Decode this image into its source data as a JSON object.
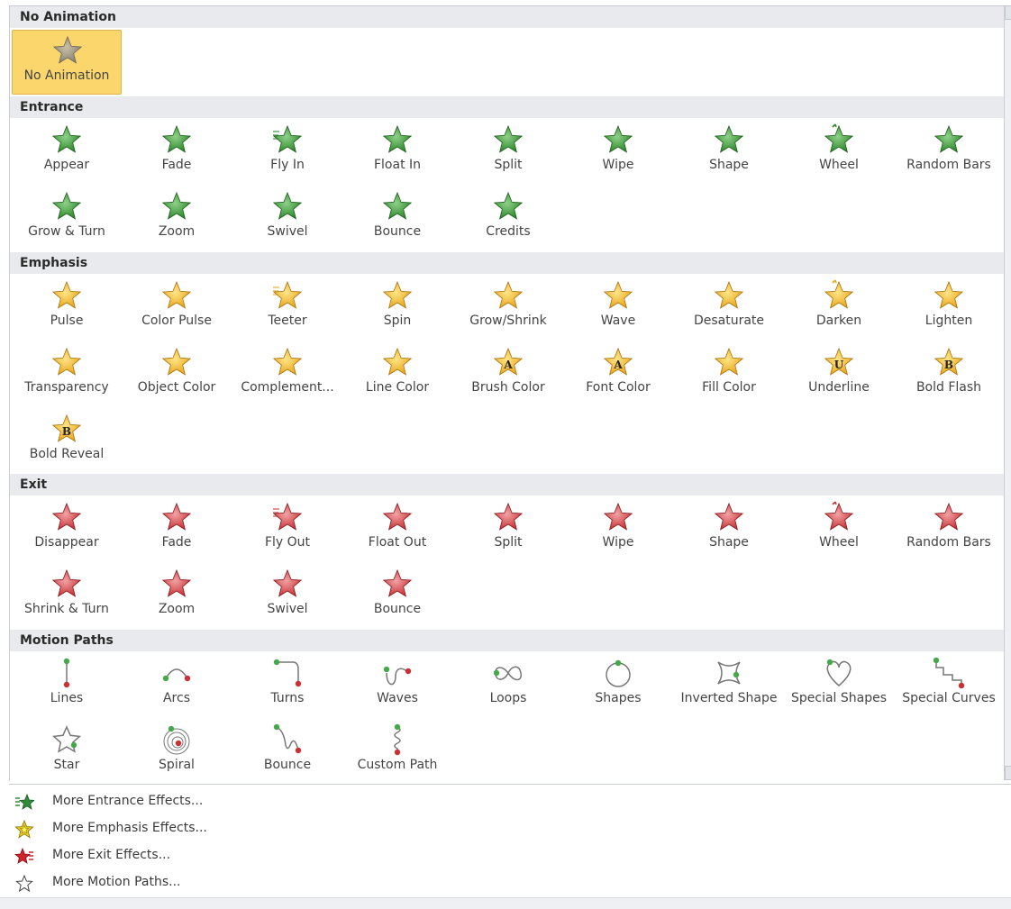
{
  "sections": [
    {
      "title": "No Animation",
      "items": [
        {
          "label": "No Animation",
          "icon": "gray-star-icon",
          "selected": true
        }
      ]
    },
    {
      "title": "Entrance",
      "items": [
        {
          "label": "Appear",
          "icon": "green-star-icon"
        },
        {
          "label": "Fade",
          "icon": "green-star-icon"
        },
        {
          "label": "Fly In",
          "icon": "green-star-icon"
        },
        {
          "label": "Float In",
          "icon": "green-star-icon"
        },
        {
          "label": "Split",
          "icon": "green-star-icon"
        },
        {
          "label": "Wipe",
          "icon": "green-star-icon"
        },
        {
          "label": "Shape",
          "icon": "green-star-icon"
        },
        {
          "label": "Wheel",
          "icon": "green-star-icon"
        },
        {
          "label": "Random Bars",
          "icon": "green-star-icon"
        },
        {
          "label": "Grow & Turn",
          "icon": "green-star-icon"
        },
        {
          "label": "Zoom",
          "icon": "green-star-icon"
        },
        {
          "label": "Swivel",
          "icon": "green-star-icon"
        },
        {
          "label": "Bounce",
          "icon": "green-star-icon"
        },
        {
          "label": "Credits",
          "icon": "green-star-icon"
        }
      ]
    },
    {
      "title": "Emphasis",
      "items": [
        {
          "label": "Pulse",
          "icon": "gold-star-icon"
        },
        {
          "label": "Color Pulse",
          "icon": "gold-star-icon"
        },
        {
          "label": "Teeter",
          "icon": "gold-star-icon"
        },
        {
          "label": "Spin",
          "icon": "gold-star-icon"
        },
        {
          "label": "Grow/Shrink",
          "icon": "gold-star-icon"
        },
        {
          "label": "Wave",
          "icon": "gold-star-icon"
        },
        {
          "label": "Desaturate",
          "icon": "gold-star-icon"
        },
        {
          "label": "Darken",
          "icon": "gold-star-icon"
        },
        {
          "label": "Lighten",
          "icon": "gold-star-icon"
        },
        {
          "label": "Transparency",
          "icon": "gold-star-icon"
        },
        {
          "label": "Object Color",
          "icon": "gold-star-icon"
        },
        {
          "label": "Complement...",
          "icon": "gold-star-icon"
        },
        {
          "label": "Line Color",
          "icon": "gold-star-icon"
        },
        {
          "label": "Brush Color",
          "icon": "gold-star-icon",
          "glyph": "A"
        },
        {
          "label": "Font Color",
          "icon": "gold-star-icon",
          "glyph": "A"
        },
        {
          "label": "Fill Color",
          "icon": "gold-star-icon"
        },
        {
          "label": "Underline",
          "icon": "gold-star-icon",
          "glyph": "U"
        },
        {
          "label": "Bold Flash",
          "icon": "gold-star-icon",
          "glyph": "B"
        },
        {
          "label": "Bold Reveal",
          "icon": "gold-star-icon",
          "glyph": "B"
        }
      ]
    },
    {
      "title": "Exit",
      "items": [
        {
          "label": "Disappear",
          "icon": "red-star-icon"
        },
        {
          "label": "Fade",
          "icon": "red-star-icon"
        },
        {
          "label": "Fly Out",
          "icon": "red-star-icon"
        },
        {
          "label": "Float Out",
          "icon": "red-star-icon"
        },
        {
          "label": "Split",
          "icon": "red-star-icon"
        },
        {
          "label": "Wipe",
          "icon": "red-star-icon"
        },
        {
          "label": "Shape",
          "icon": "red-star-icon"
        },
        {
          "label": "Wheel",
          "icon": "red-star-icon"
        },
        {
          "label": "Random Bars",
          "icon": "red-star-icon"
        },
        {
          "label": "Shrink & Turn",
          "icon": "red-star-icon"
        },
        {
          "label": "Zoom",
          "icon": "red-star-icon"
        },
        {
          "label": "Swivel",
          "icon": "red-star-icon"
        },
        {
          "label": "Bounce",
          "icon": "red-star-icon"
        }
      ]
    },
    {
      "title": "Motion Paths",
      "items": [
        {
          "label": "Lines",
          "icon": "line-path-icon"
        },
        {
          "label": "Arcs",
          "icon": "arc-path-icon"
        },
        {
          "label": "Turns",
          "icon": "turn-path-icon"
        },
        {
          "label": "Waves",
          "icon": "wave-path-icon"
        },
        {
          "label": "Loops",
          "icon": "loop-path-icon"
        },
        {
          "label": "Shapes",
          "icon": "circle-path-icon"
        },
        {
          "label": "Inverted Shape",
          "icon": "inverted-shape-path-icon"
        },
        {
          "label": "Special Shapes",
          "icon": "heart-path-icon"
        },
        {
          "label": "Special Curves",
          "icon": "stair-path-icon"
        },
        {
          "label": "Star",
          "icon": "star-path-icon"
        },
        {
          "label": "Spiral",
          "icon": "spiral-path-icon"
        },
        {
          "label": "Bounce",
          "icon": "bounce-path-icon"
        },
        {
          "label": "Custom Path",
          "icon": "custom-path-icon"
        }
      ]
    }
  ],
  "more": [
    {
      "label": "More Entrance Effects...",
      "icon": "entrance-star-icon",
      "color": "#2e8b3a"
    },
    {
      "label": "More Emphasis Effects...",
      "icon": "emphasis-star-icon",
      "color": "#f2d21a"
    },
    {
      "label": "More Exit Effects...",
      "icon": "exit-star-icon",
      "color": "#d2232a"
    },
    {
      "label": "More Motion Paths...",
      "icon": "motion-path-star-icon",
      "color": "#ffffff"
    }
  ],
  "colors": {
    "green": "#3f9a3c",
    "gold": "#f0b429",
    "red": "#c9363a",
    "gray": "#8c8c8c",
    "selected": "#fbd66d"
  }
}
